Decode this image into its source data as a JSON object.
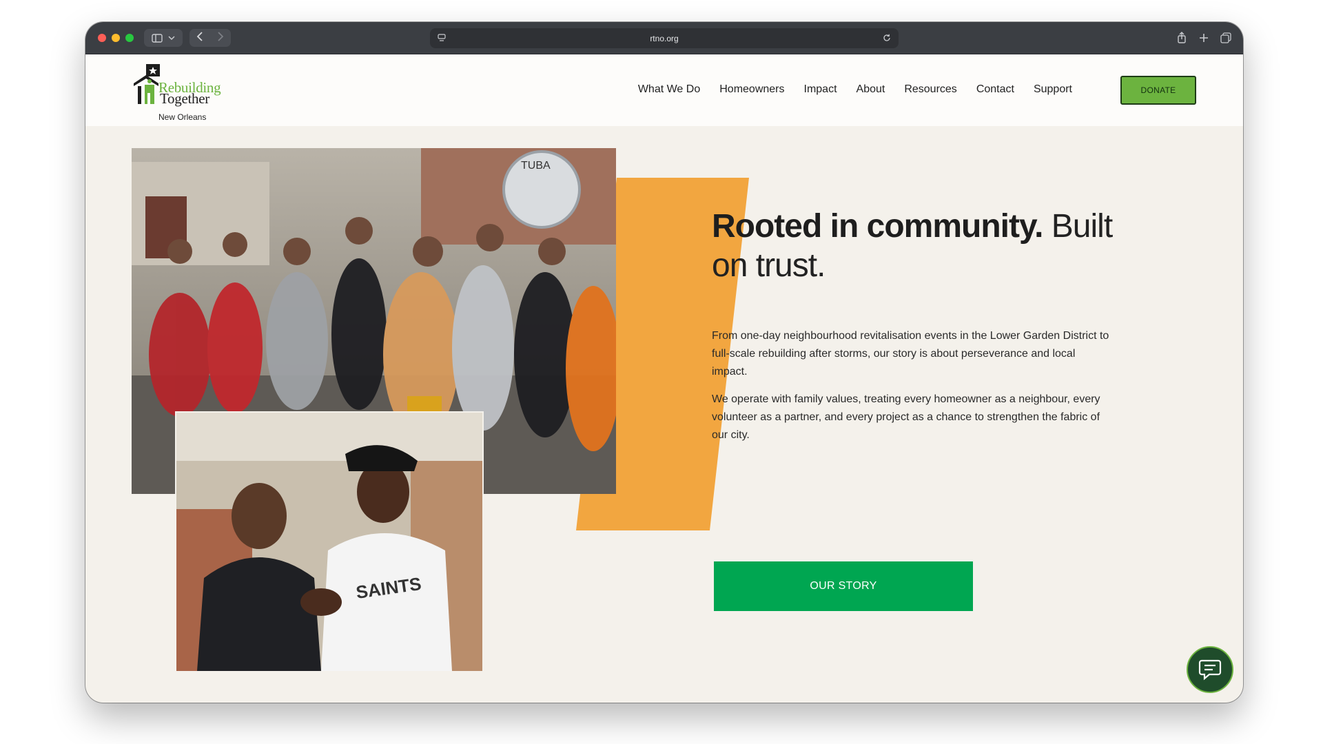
{
  "browser": {
    "url": "rtno.org"
  },
  "logo": {
    "line1": "Rebuilding",
    "line2": "Together",
    "line3": "New Orleans"
  },
  "nav": {
    "items": [
      "What We Do",
      "Homeowners",
      "Impact",
      "About",
      "Resources",
      "Contact",
      "Support"
    ]
  },
  "header": {
    "donate_label": "DONATE"
  },
  "hero": {
    "headline_bold": "Rooted in community.",
    "headline_light": " Built on trust.",
    "paragraph1": "From one-day neighbourhood revitalisation events in the Lower Garden District to full-scale rebuilding after storms, our story is about perseverance and local impact.",
    "paragraph2": "We operate with family values, treating every homeowner as a neighbour, every volunteer as a partner, and every project as a chance to strengthen the fabric of our city.",
    "cta_label": "OUR STORY"
  },
  "colors": {
    "brand_green": "#6cb33f",
    "cta_green": "#00a651",
    "accent_orange": "#f2a640",
    "chat_bg": "#1f4c2b"
  }
}
